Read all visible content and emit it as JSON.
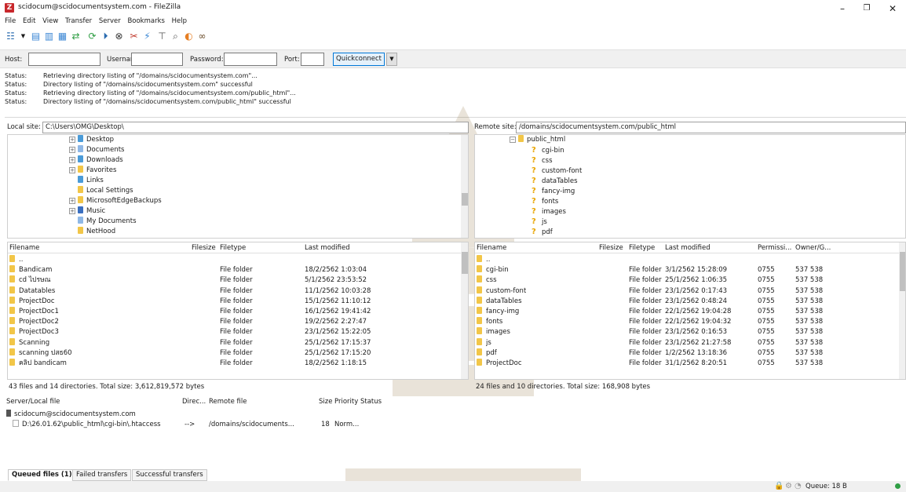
{
  "window": {
    "title": "scidocum@scidocumentsystem.com - FileZilla",
    "minimize": "–",
    "maximize": "❐",
    "close": "✕"
  },
  "menu": [
    "File",
    "Edit",
    "View",
    "Transfer",
    "Server",
    "Bookmarks",
    "Help"
  ],
  "quickconnect": {
    "host_label": "Host:",
    "username_label": "Username:",
    "password_label": "Password:",
    "port_label": "Port:",
    "button": "Quickconnect",
    "host_value": "",
    "username_value": "",
    "password_value": "",
    "port_value": ""
  },
  "status_log": [
    {
      "label": "Status:",
      "text": "Retrieving directory listing of \"/domains/scidocumentsystem.com\"..."
    },
    {
      "label": "Status:",
      "text": "Directory listing of \"/domains/scidocumentsystem.com\" successful"
    },
    {
      "label": "Status:",
      "text": "Retrieving directory listing of \"/domains/scidocumentsystem.com/public_html\"..."
    },
    {
      "label": "Status:",
      "text": "Directory listing of \"/domains/scidocumentsystem.com/public_html\" successful"
    }
  ],
  "local": {
    "site_label": "Local site:",
    "site_path": "C:\\Users\\OMG\\Desktop\\",
    "tree": [
      "Desktop",
      "Documents",
      "Downloads",
      "Favorites",
      "Links",
      "Local Settings",
      "MicrosoftEdgeBackups",
      "Music",
      "My Documents",
      "NetHood"
    ],
    "columns": {
      "name": "Filename",
      "size": "Filesize",
      "type": "Filetype",
      "modified": "Last modified"
    },
    "files": [
      {
        "name": "..",
        "type": "",
        "modified": ""
      },
      {
        "name": "Bandicam",
        "type": "File folder",
        "modified": "18/2/2562 1:03:04"
      },
      {
        "name": "cd ไปรษณ",
        "type": "File folder",
        "modified": "5/1/2562 23:53:52"
      },
      {
        "name": "Datatables",
        "type": "File folder",
        "modified": "11/1/2562 10:03:28"
      },
      {
        "name": "ProjectDoc",
        "type": "File folder",
        "modified": "15/1/2562 11:10:12"
      },
      {
        "name": "ProjectDoc1",
        "type": "File folder",
        "modified": "16/1/2562 19:41:42"
      },
      {
        "name": "ProjectDoc2",
        "type": "File folder",
        "modified": "19/2/2562 2:27:47"
      },
      {
        "name": "ProjectDoc3",
        "type": "File folder",
        "modified": "23/1/2562 15:22:05"
      },
      {
        "name": "Scanning",
        "type": "File folder",
        "modified": "25/1/2562 17:15:37"
      },
      {
        "name": "scanning ปสธ60",
        "type": "File folder",
        "modified": "25/1/2562 17:15:20"
      },
      {
        "name": "คลิป bandicam",
        "type": "File folder",
        "modified": "18/2/2562 1:18:15"
      }
    ],
    "summary": "43 files and 14 directories. Total size: 3,612,819,572 bytes"
  },
  "remote": {
    "site_label": "Remote site:",
    "site_path": "/domains/scidocumentsystem.com/public_html",
    "tree_root": "public_html",
    "tree": [
      "cgi-bin",
      "css",
      "custom-font",
      "dataTables",
      "fancy-img",
      "fonts",
      "images",
      "js",
      "pdf"
    ],
    "columns": {
      "name": "Filename",
      "size": "Filesize",
      "type": "Filetype",
      "modified": "Last modified",
      "perms": "Permissi...",
      "owner": "Owner/G..."
    },
    "files": [
      {
        "name": "..",
        "type": "",
        "modified": "",
        "perms": "",
        "owner": ""
      },
      {
        "name": "cgi-bin",
        "type": "File folder",
        "modified": "3/1/2562 15:28:09",
        "perms": "0755",
        "owner": "537 538"
      },
      {
        "name": "css",
        "type": "File folder",
        "modified": "25/1/2562 1:06:35",
        "perms": "0755",
        "owner": "537 538"
      },
      {
        "name": "custom-font",
        "type": "File folder",
        "modified": "23/1/2562 0:17:43",
        "perms": "0755",
        "owner": "537 538"
      },
      {
        "name": "dataTables",
        "type": "File folder",
        "modified": "23/1/2562 0:48:24",
        "perms": "0755",
        "owner": "537 538"
      },
      {
        "name": "fancy-img",
        "type": "File folder",
        "modified": "22/1/2562 19:04:28",
        "perms": "0755",
        "owner": "537 538"
      },
      {
        "name": "fonts",
        "type": "File folder",
        "modified": "22/1/2562 19:04:32",
        "perms": "0755",
        "owner": "537 538"
      },
      {
        "name": "images",
        "type": "File folder",
        "modified": "23/1/2562 0:16:53",
        "perms": "0755",
        "owner": "537 538"
      },
      {
        "name": "js",
        "type": "File folder",
        "modified": "23/1/2562 21:27:58",
        "perms": "0755",
        "owner": "537 538"
      },
      {
        "name": "pdf",
        "type": "File folder",
        "modified": "1/2/2562 13:18:36",
        "perms": "0755",
        "owner": "537 538"
      },
      {
        "name": "ProjectDoc",
        "type": "File folder",
        "modified": "31/1/2562 8:20:51",
        "perms": "0755",
        "owner": "537 538"
      }
    ],
    "summary": "24 files and 10 directories. Total size: 168,908 bytes"
  },
  "queue": {
    "columns": {
      "file": "Server/Local file",
      "direction": "Direc...",
      "remote": "Remote file",
      "size": "Size",
      "priority": "Priority",
      "status": "Status"
    },
    "server": "scidocum@scidocumentsystem.com",
    "item": {
      "local": "D:\\26.01.62\\public_html\\cgi-bin\\.htaccess",
      "direction": "-->",
      "remote": "/domains/scidocuments...",
      "size": "18",
      "priority": "Norm..."
    },
    "tabs": [
      "Queued files (1)",
      "Failed transfers",
      "Successful transfers"
    ]
  },
  "statusbar": {
    "queue": "Queue: 18 B"
  },
  "colors": {
    "folder": "#f2c648",
    "accent": "#0078d7",
    "question": "#e8a400"
  }
}
